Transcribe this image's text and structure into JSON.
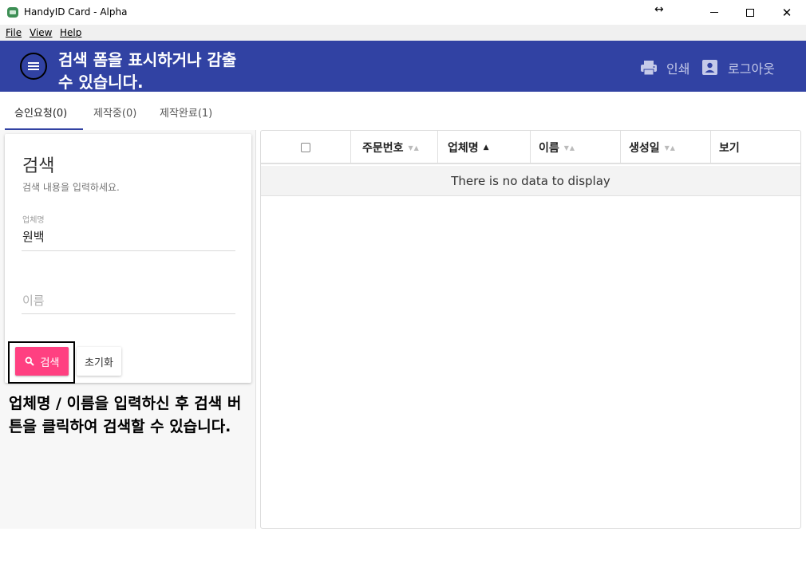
{
  "window": {
    "title": "HandyID Card - Alpha",
    "resize_glyph": "↔",
    "controls": [
      "minimize",
      "maximize",
      "close"
    ],
    "close_glyph": "✕"
  },
  "menubar": {
    "items": [
      "File",
      "View",
      "Help"
    ]
  },
  "appbar": {
    "color": "#3142a3",
    "menu_icon": "hamburger-menu-icon",
    "annotation": "검색 폼을 표시하거나 감출 수 있습니다.",
    "actions": [
      {
        "icon": "printer-icon",
        "label": "인쇄"
      },
      {
        "icon": "account-box-icon",
        "label": "로그아웃"
      }
    ]
  },
  "tabs": [
    {
      "label": "승인요청(0)",
      "active": true
    },
    {
      "label": "제작중(0)",
      "active": false
    },
    {
      "label": "제작완료(1)",
      "active": false
    }
  ],
  "search_card": {
    "title": "검색",
    "subtitle": "검색 내용을 입력하세요.",
    "company_label": "업체명",
    "company_value": "원백",
    "name_placeholder": "이름",
    "search_button": "검색",
    "search_icon": "search-icon",
    "search_button_color": "#ff4081",
    "reset_button": "초기화"
  },
  "annotation_bottom": "업체명 / 이름을 입력하신 후 검색 버튼을 클릭하여 검색할 수 있습니다.",
  "table": {
    "columns": [
      {
        "label": "",
        "type": "checkbox"
      },
      {
        "label": "주문번호",
        "sort": "none"
      },
      {
        "label": "업체명",
        "sort": "asc"
      },
      {
        "label": "이름",
        "sort": "none"
      },
      {
        "label": "생성일",
        "sort": "none"
      },
      {
        "label": "보기",
        "sort": "disabled"
      }
    ],
    "empty_message": "There is no data to display"
  }
}
